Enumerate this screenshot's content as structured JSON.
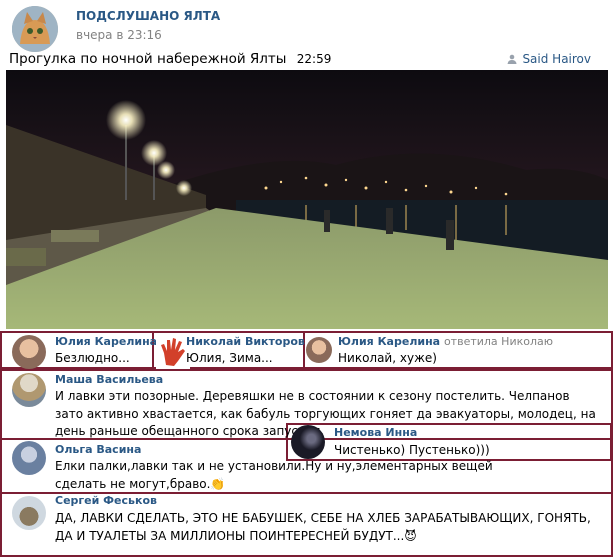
{
  "post": {
    "group_name": "ПОДСЛУШАНО ЯЛТА",
    "time": "вчера в 23:16",
    "text": "Прогулка по ночной набережной Ялты",
    "text_time": "22:59",
    "author": "Said Hairov"
  },
  "comments": [
    {
      "name": "Юлия Карелина",
      "text": "Безлюдно..."
    },
    {
      "name": "Николай Викторов",
      "text": "Юлия, Зима..."
    },
    {
      "name": "Юлия Карелина",
      "reply": "ответила Николаю",
      "text": "Николай, хуже)"
    },
    {
      "name": "Маша Васильева",
      "text": "И лавки эти позорные. Деревяшки не в состоянии к сезону постелить. Челпанов зато активно хвастается, как бабуль торгующих гоняет да эвакуаторы, молодец, на день раньше обещанного срока запустил."
    },
    {
      "name": "Немова Инна",
      "text": "Чистенько) Пустенько)))"
    },
    {
      "name": "Ольга Васина",
      "text": "Елки палки,лавки так и не установили.Ну и ну,элементарных вещей сделать не могут,браво.👏"
    },
    {
      "name": "Сергей Феськов",
      "text": "ДА, ЛАВКИ СДЕЛАТЬ, ЭТО НЕ БАБУШЕК, СЕБЕ НА ХЛЕБ ЗАРАБАТЫВАЮЩИХ, ГОНЯТЬ, ДА И ТУАЛЕТЫ ЗА МИЛЛИОНЫ ПОИНТЕРЕСНЕЙ БУДУТ...😈"
    }
  ],
  "colors": {
    "link": "#2a5885",
    "frame": "#7b1e34",
    "muted": "#828282"
  }
}
